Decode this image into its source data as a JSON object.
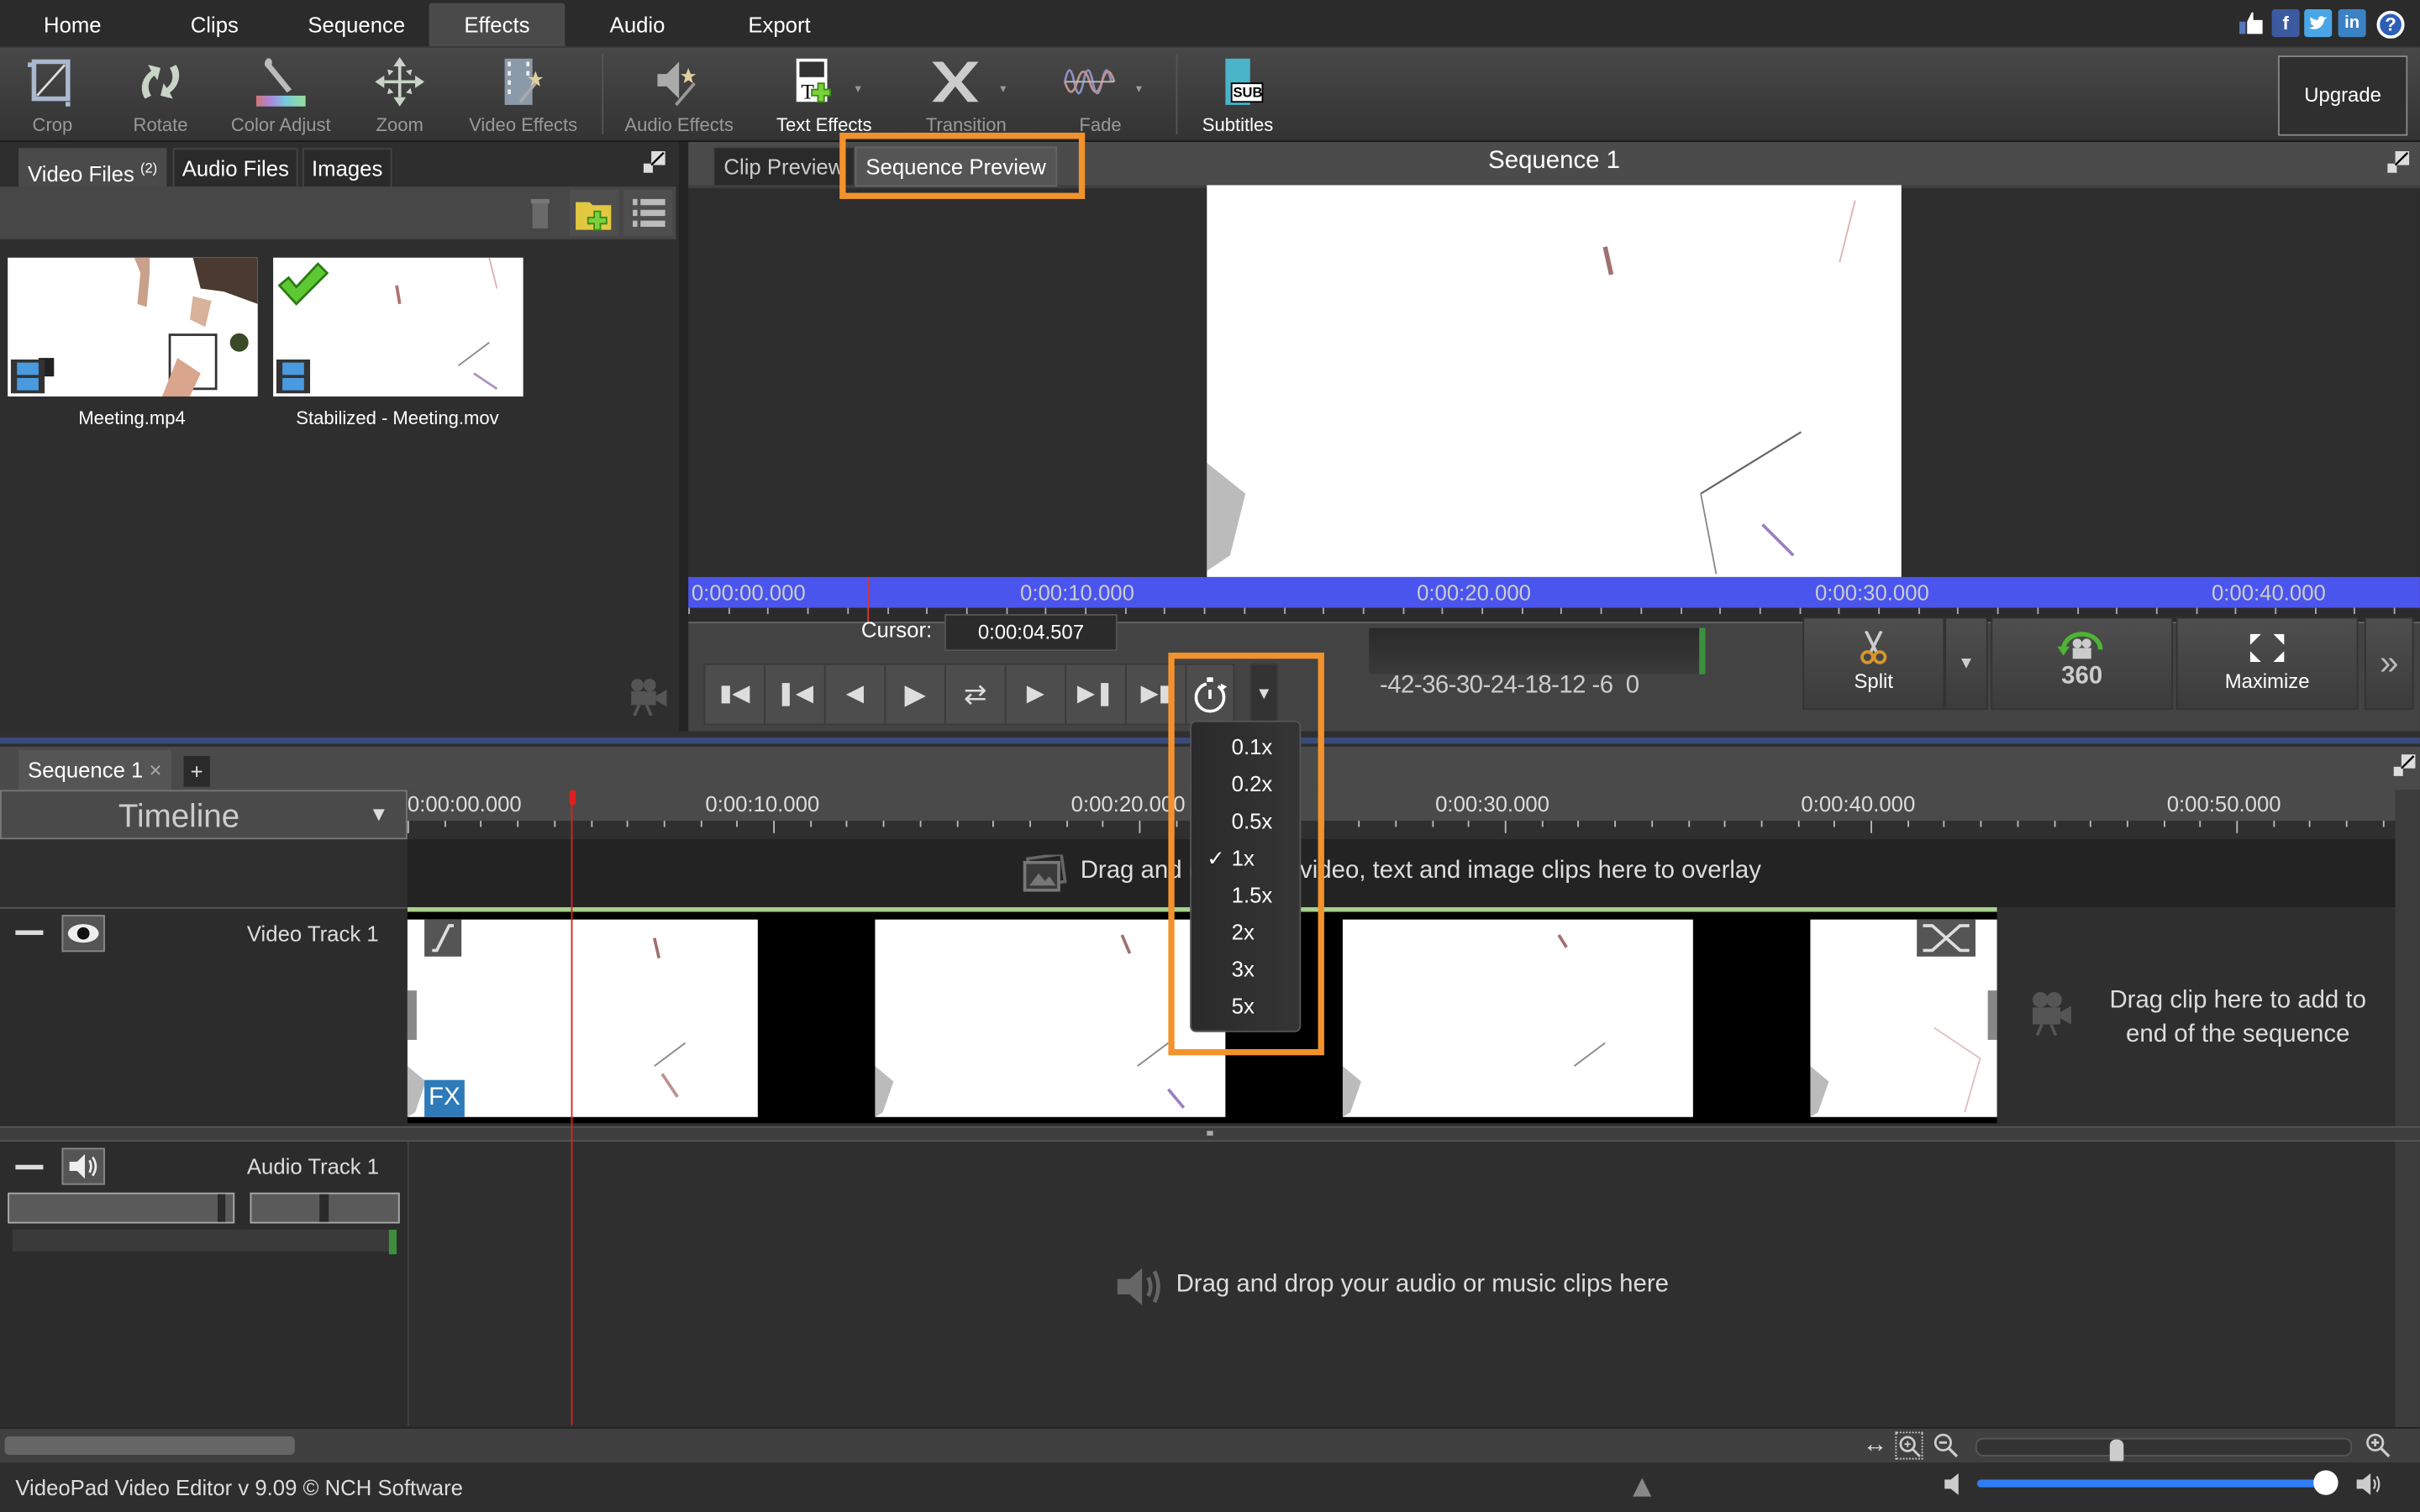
{
  "menu": {
    "tabs": [
      "Home",
      "Clips",
      "Sequence",
      "Effects",
      "Audio",
      "Export"
    ],
    "active_tab": "Effects",
    "social_icons": [
      "thumbs-up-icon",
      "facebook-icon",
      "twitter-icon",
      "linkedin-icon",
      "help-icon"
    ]
  },
  "toolbar": {
    "items": [
      {
        "label": "Crop",
        "icon": "crop-icon"
      },
      {
        "label": "Rotate",
        "icon": "rotate-icon"
      },
      {
        "label": "Color Adjust",
        "icon": "color-adjust-icon"
      },
      {
        "label": "Zoom",
        "icon": "zoom-icon"
      },
      {
        "label": "Video Effects",
        "icon": "video-effects-icon"
      },
      {
        "label": "Audio Effects",
        "icon": "audio-effects-icon"
      },
      {
        "label": "Text Effects",
        "icon": "text-effects-icon"
      },
      {
        "label": "Transition",
        "icon": "transition-icon"
      },
      {
        "label": "Fade",
        "icon": "fade-icon"
      },
      {
        "label": "Subtitles",
        "icon": "subtitles-icon"
      }
    ],
    "subtitles_badge": "SUB",
    "upgrade_label": "Upgrade"
  },
  "files": {
    "tabs": [
      {
        "label": "Video Files",
        "count": "(2)"
      },
      {
        "label": "Audio Files"
      },
      {
        "label": "Images"
      }
    ],
    "items": [
      {
        "name": "Meeting.mp4",
        "checked": false
      },
      {
        "name": "Stabilized - Meeting.mov",
        "checked": true
      }
    ]
  },
  "preview": {
    "tabs": [
      "Clip Preview",
      "Sequence Preview"
    ],
    "active_tab": "Sequence Preview",
    "title": "Sequence 1",
    "ruler_labels": [
      "0:00:00.000",
      "0:00:10.000",
      "0:00:20.000",
      "0:00:30.000",
      "0:00:40.000"
    ],
    "cursor_label": "Cursor:",
    "cursor_value": "0:00:04.507",
    "meter_scale": "-42-36-30-24-18-12 -6  0",
    "split_label": "Split",
    "vr_label": "360",
    "maximize_label": "Maximize"
  },
  "speed_menu": {
    "options": [
      "0.1x",
      "0.2x",
      "0.5x",
      "1x",
      "1.5x",
      "2x",
      "3x",
      "5x"
    ],
    "selected": "1x",
    "check_mark": "✓"
  },
  "sequence": {
    "tab_label": "Sequence 1",
    "close_glyph": "×",
    "add_glyph": "+",
    "timeline_label": "Timeline",
    "ruler_labels": [
      "0:00:00.000",
      "0:00:10.000",
      "0:00:20.000",
      "0:00:30.000",
      "0:00:40.000",
      "0:00:50.000"
    ],
    "overlay_hint": "Drag and drop your video, text and image clips here to overlay",
    "video_track_label": "Video Track 1",
    "audio_track_label": "Audio Track 1",
    "fx_badge": "FX",
    "end_hint_line1": "Drag clip here to add to",
    "end_hint_line2": "end of the sequence",
    "audio_hint": "Drag and drop your audio or music clips here"
  },
  "status": {
    "text": "VideoPad Video Editor v 9.09 © NCH Software",
    "volume_percent": 100,
    "timeline_zoom_fraction": 0.37
  },
  "colors": {
    "highlight": "#f2922c",
    "ruler_blue": "#4a55ee",
    "track_green": "#a8d08d",
    "fx_blue": "#2f7ab8",
    "volume_blue": "#2e7cf6"
  }
}
